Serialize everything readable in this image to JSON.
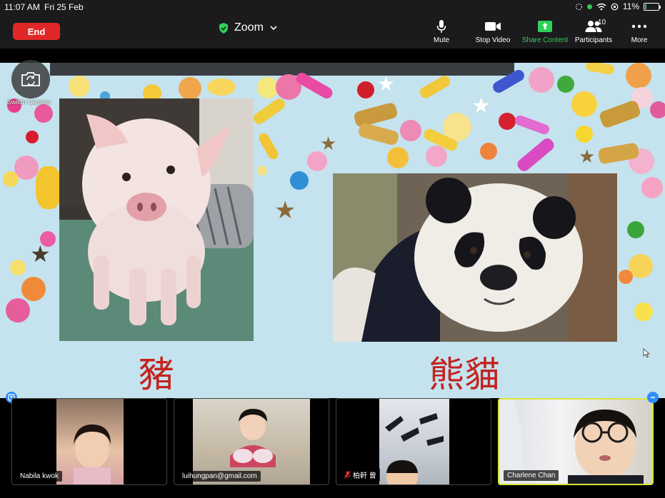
{
  "status_bar": {
    "time": "11:07 AM",
    "date": "Fri 25 Feb",
    "battery": "11%",
    "battery_level": 0.11
  },
  "toolbar": {
    "end_label": "End",
    "meeting_title": "Zoom",
    "mute_label": "Mute",
    "stop_video_label": "Stop Video",
    "share_content_label": "Share Content",
    "participants_label": "Participants",
    "participants_count": "10",
    "more_label": "More"
  },
  "stage": {
    "switch_camera_label": "Switch Camera",
    "caption_left": "豬",
    "caption_right": "熊貓"
  },
  "gallery": [
    {
      "name": "Nabila kwok",
      "muted": false
    },
    {
      "name": "luihungpan@gmail.com",
      "muted": false
    },
    {
      "name": "柏軒 曾",
      "muted": true
    },
    {
      "name": "Charlene Chan",
      "muted": false
    }
  ],
  "colors": {
    "end_button": "#e02828",
    "share_green": "#30d158",
    "caption_red": "#c5221f",
    "background_blue": "#c4e3ee"
  }
}
